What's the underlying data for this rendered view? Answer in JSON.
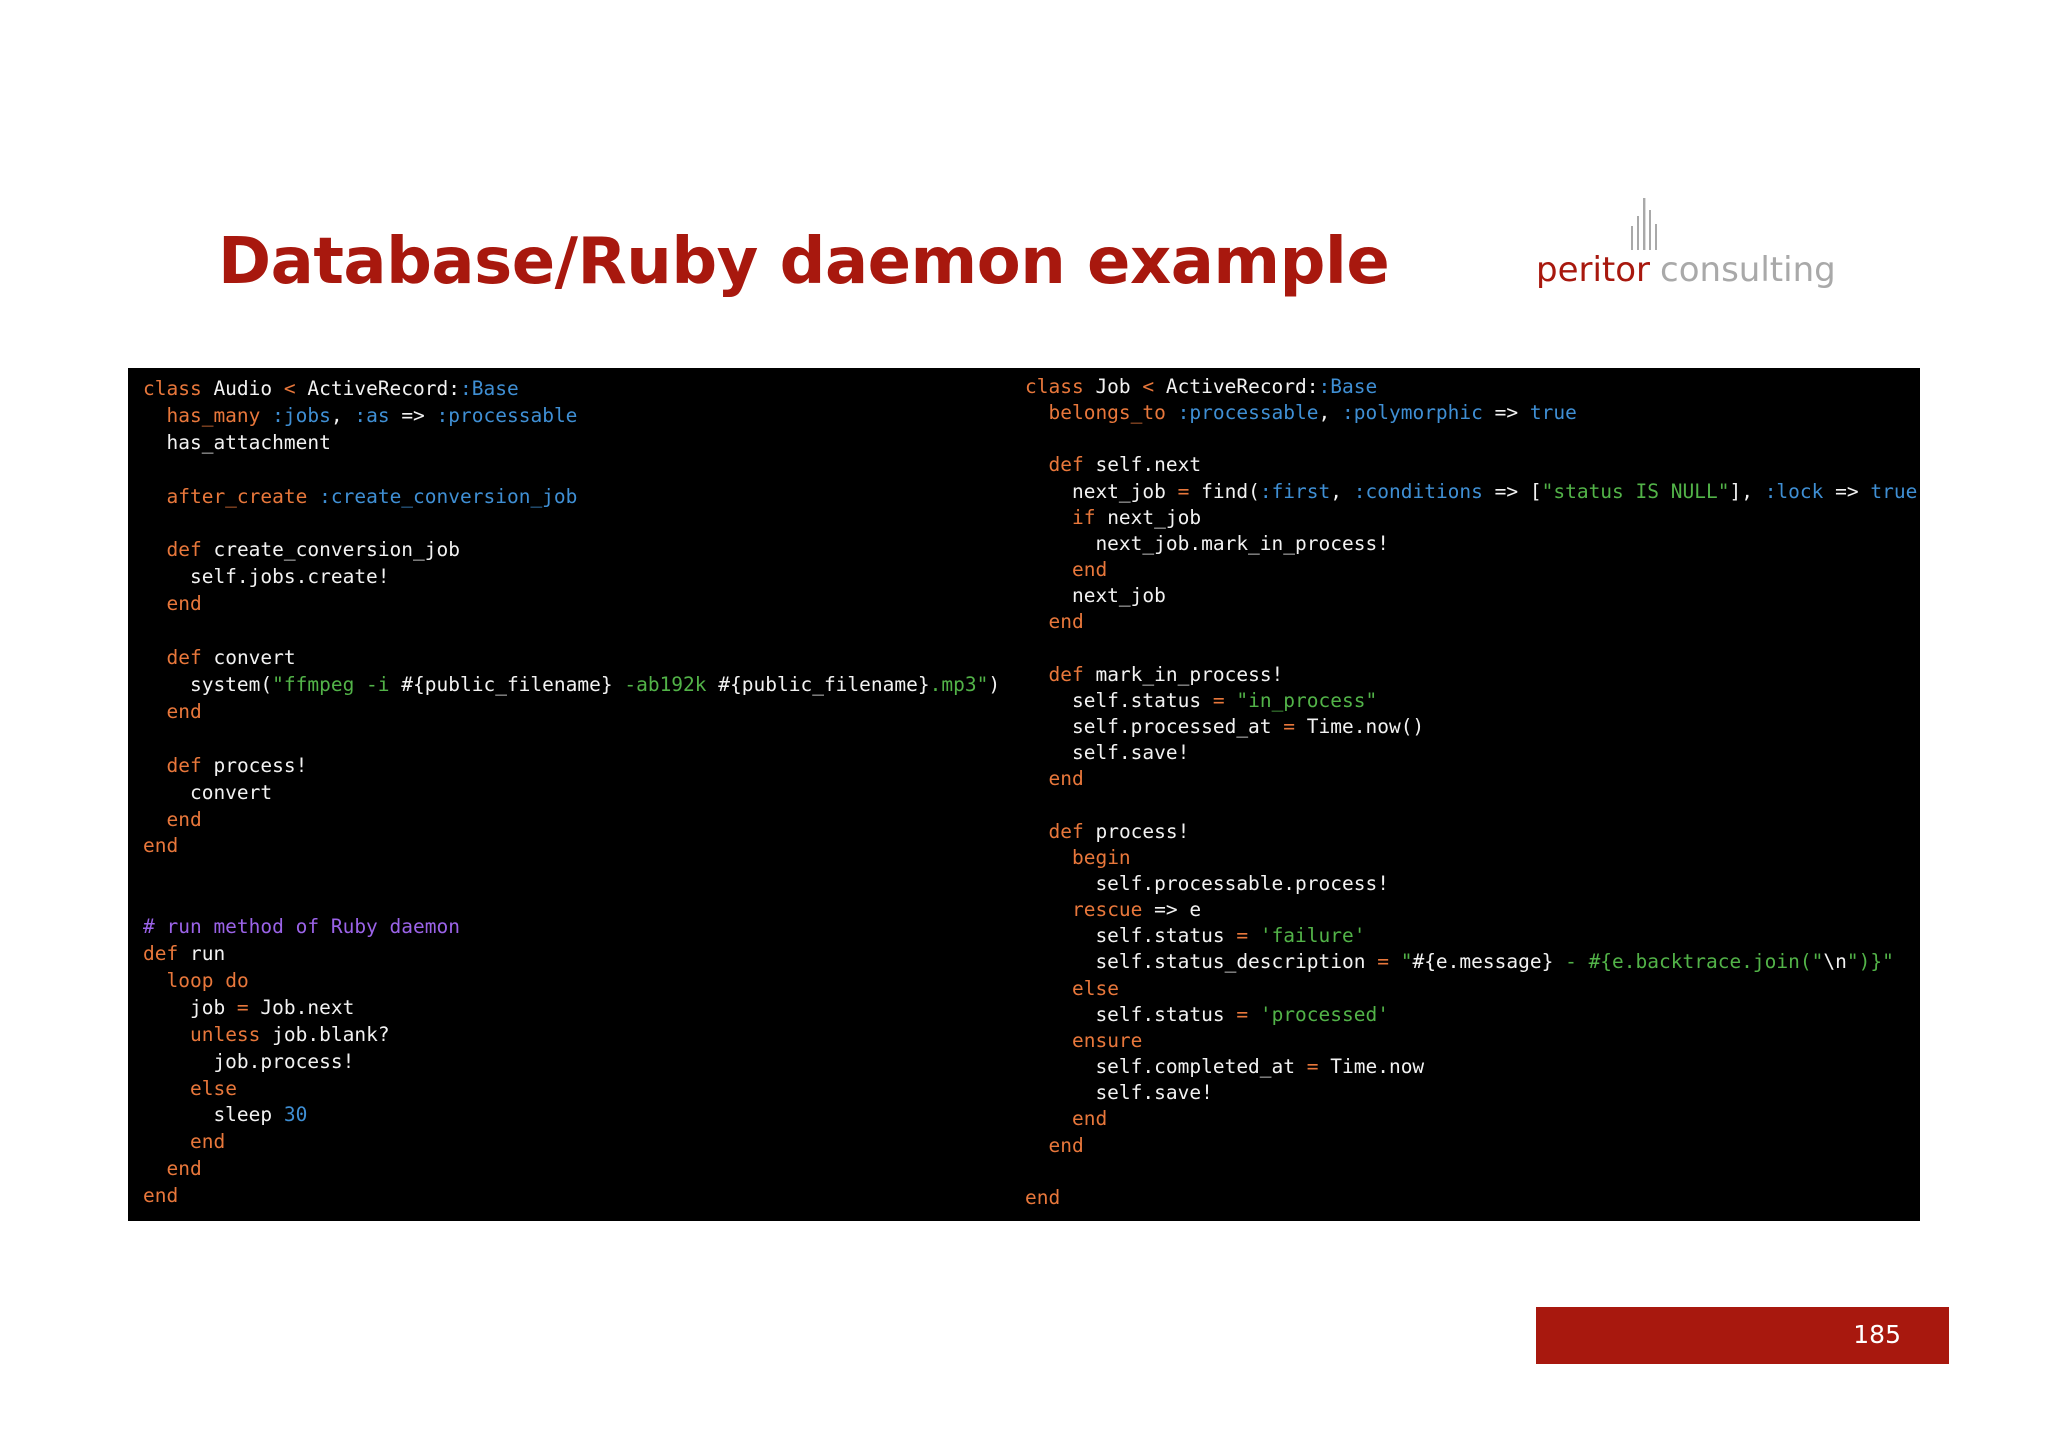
{
  "slide": {
    "title": "Database/Ruby daemon example",
    "page_number": "185"
  },
  "logo": {
    "word1": "peritor",
    "word2": "consulting"
  },
  "code": {
    "left_lines": [
      "class Audio < ActiveRecord::Base",
      "  has_many :jobs, :as => :processable",
      "  has_attachment",
      "",
      "  after_create :create_conversion_job",
      "",
      "  def create_conversion_job",
      "    self.jobs.create!",
      "  end",
      "",
      "  def convert",
      "    system(\"ffmpeg -i #{public_filename} -ab192k #{public_filename}.mp3\")",
      "  end",
      "",
      "  def process!",
      "    convert",
      "  end",
      "end",
      "",
      "",
      "# run method of Ruby daemon",
      "def run",
      "  loop do",
      "    job = Job.next",
      "    unless job.blank?",
      "      job.process!",
      "    else",
      "      sleep 30",
      "    end",
      "  end",
      "end"
    ],
    "right_lines": [
      "class Job < ActiveRecord::Base",
      "  belongs_to :processable, :polymorphic => true",
      "",
      "  def self.next",
      "    next_job = find(:first, :conditions => [\"status IS NULL\"], :lock => true)",
      "    if next_job",
      "      next_job.mark_in_process!",
      "    end",
      "    next_job",
      "  end",
      "",
      "  def mark_in_process!",
      "    self.status = \"in_process\"",
      "    self.processed_at = Time.now()",
      "    self.save!",
      "  end",
      "",
      "  def process!",
      "    begin",
      "      self.processable.process!",
      "    rescue => e",
      "      self.status = 'failure'",
      "      self.status_description = \"#{e.message} - #{e.backtrace.join(\"\\n\")}\"",
      "    else",
      "      self.status = 'processed'",
      "    ensure",
      "      self.completed_at = Time.now",
      "      self.save!",
      "    end",
      "  end",
      "",
      "end"
    ]
  },
  "colors": {
    "brand_red": "#a8180e",
    "logo_grey": "#a9a9a9",
    "code_background": "#000000",
    "code_keyword": "#e8773b",
    "code_symbol": "#3f8fd4",
    "code_string": "#52b348",
    "code_comment": "#9b63e8"
  }
}
